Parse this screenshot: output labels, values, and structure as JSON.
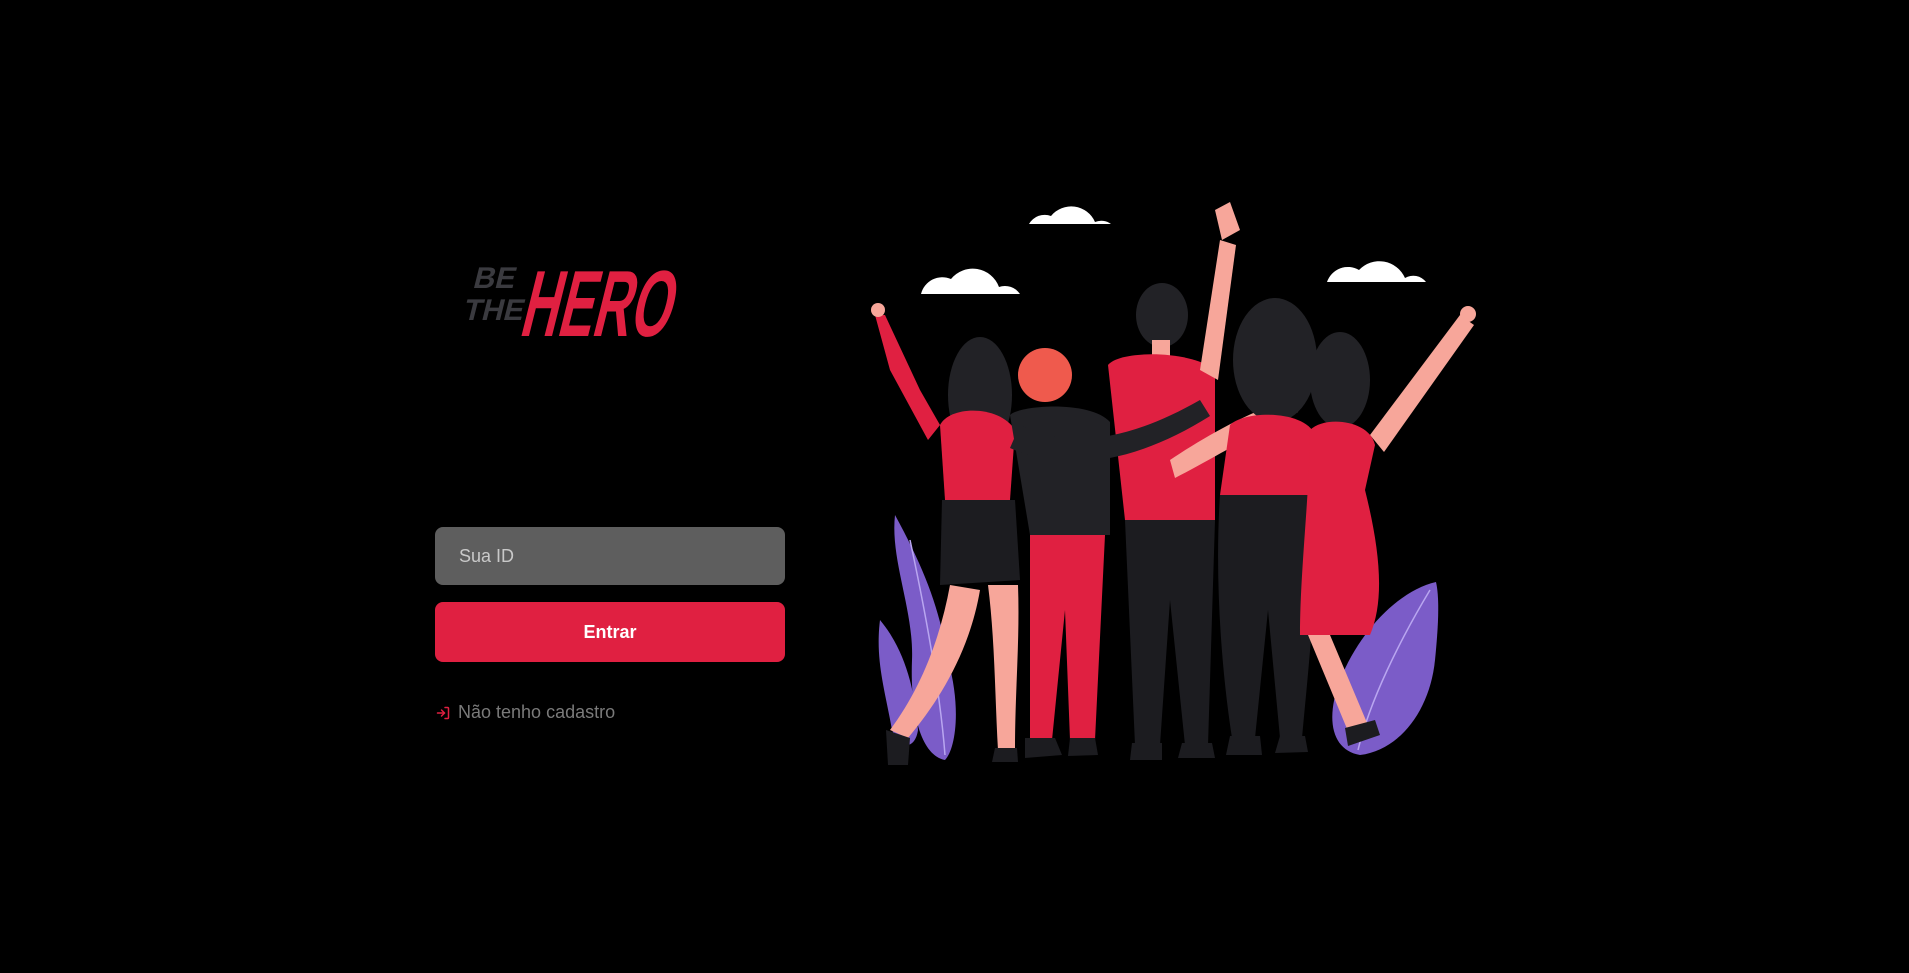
{
  "logo": {
    "line1": "BE",
    "line2": "THE",
    "brand": "HERO"
  },
  "form": {
    "id_input": {
      "placeholder": "Sua ID",
      "value": ""
    },
    "submit_label": "Entrar",
    "register_link_label": "Não tenho cadastro",
    "register_icon": "log-in-icon"
  },
  "colors": {
    "background": "#000000",
    "accent": "#e02041",
    "input_bg": "#5e5e5e",
    "muted_text": "#7a7a7a",
    "logo_gray": "#3a3a3f"
  },
  "illustration": {
    "icon": "group-of-heroes-illustration"
  }
}
